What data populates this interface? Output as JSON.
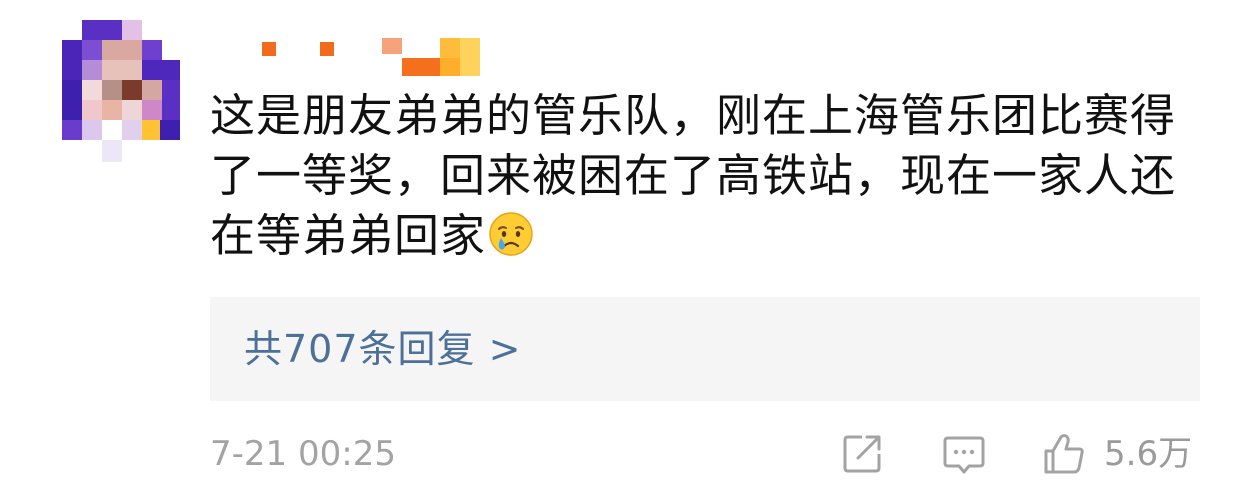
{
  "comment": {
    "avatar_icon": "pixelated-avatar",
    "username_icon": "pixelated-username",
    "text": "这是朋友弟弟的管乐队，刚在上海管乐团比赛得了一等奖，回来被困在了高铁站，现在一家人还在等弟弟回家",
    "emoji_icon": "crying-face-emoji",
    "replies_label": "共707条回复 >",
    "timestamp": "7-21 00:25",
    "share_icon": "share-icon",
    "reply_icon": "comment-icon",
    "like_icon": "thumbs-up-icon",
    "like_count": "5.6万"
  },
  "colors": {
    "link": "#4d7099",
    "text": "#111111",
    "muted": "#a3a3a3",
    "reply_bg": "#f5f5f5"
  }
}
